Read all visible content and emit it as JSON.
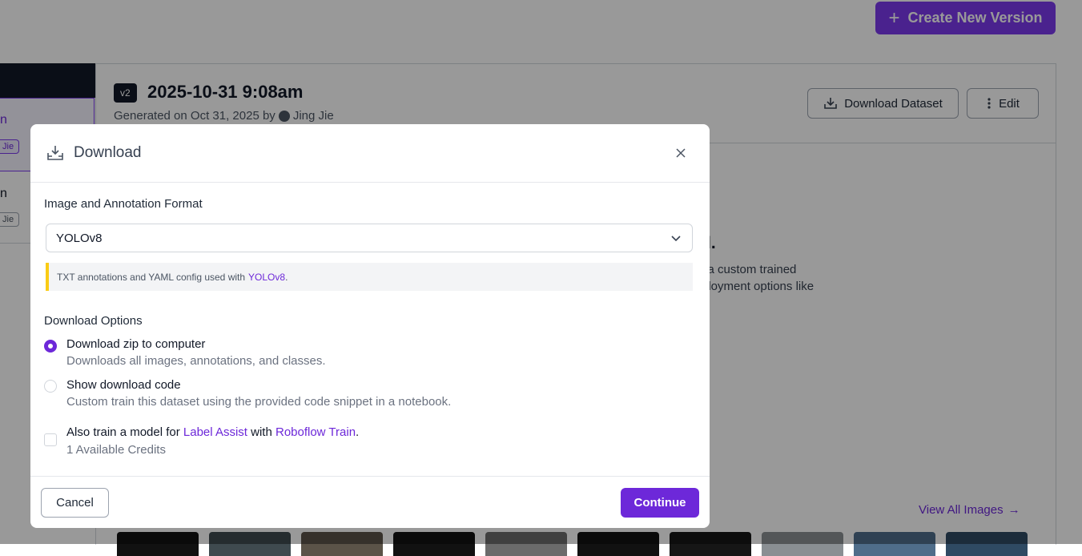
{
  "background": {
    "create_button": {
      "icon": "plus-icon",
      "label": "Create New Version"
    },
    "version_list": {
      "item1": {
        "title_fragment": "n",
        "tag_fragment": "Jie"
      },
      "item2": {
        "title_fragment": "n",
        "tag_fragment": "Jie"
      }
    },
    "version": {
      "badge": "v2",
      "title": "2025-10-31 9:08am",
      "generated_prefix": "Generated on Oct 31, 2025 by",
      "author": "Jing Jie"
    },
    "actions": {
      "download": {
        "icon": "download-icon",
        "label": "Download Dataset"
      },
      "edit": {
        "icon": "kebab-icon",
        "label": "Edit"
      }
    },
    "promo": {
      "heading_fragment": "l.",
      "line1": "l a custom trained",
      "line2": "ployment options like"
    },
    "view_all": {
      "label": "View All Images",
      "icon": "arrow-right-icon"
    }
  },
  "modal": {
    "title": "Download",
    "header_icon": "download-tray-icon",
    "close_icon": "close-icon",
    "format": {
      "label": "Image and Annotation Format",
      "selected": "YOLOv8",
      "note_text": "TXT annotations and YAML config used with",
      "note_link": "YOLOv8",
      "note_suffix": "."
    },
    "options": {
      "label": "Download Options",
      "zip": {
        "title": "Download zip to computer",
        "desc": "Downloads all images, annotations, and classes.",
        "selected": true
      },
      "code": {
        "title": "Show download code",
        "desc": "Custom train this dataset using the provided code snippet in a notebook.",
        "selected": false
      }
    },
    "train": {
      "prefix": "Also train a model for",
      "link1": "Label Assist",
      "middle": "with",
      "link2": "Roboflow Train",
      "suffix": ".",
      "credits": "1 Available Credits",
      "checked": false
    },
    "footer": {
      "cancel": "Cancel",
      "continue": "Continue"
    }
  },
  "colors": {
    "accent": "#6d28d9",
    "note_border": "#facc15"
  }
}
